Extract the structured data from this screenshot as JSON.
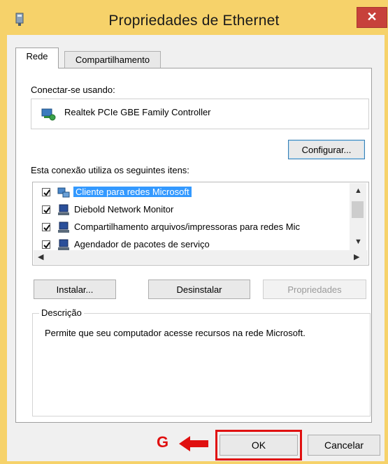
{
  "window": {
    "title": "Propriedades de Ethernet"
  },
  "tabs": [
    {
      "label": "Rede",
      "active": true
    },
    {
      "label": "Compartilhamento",
      "active": false
    }
  ],
  "connect_using": {
    "label": "Conectar-se usando:",
    "adapter": "Realtek PCIe GBE Family Controller",
    "configure_button": "Configurar..."
  },
  "items_section": {
    "label": "Esta conexão utiliza os seguintes itens:",
    "items": [
      {
        "checked": true,
        "text": "Cliente para redes Microsoft",
        "selected": true,
        "icon": "network-client-icon"
      },
      {
        "checked": true,
        "text": "Diebold Network Monitor",
        "selected": false,
        "icon": "network-service-icon"
      },
      {
        "checked": true,
        "text": "Compartilhamento arquivos/impressoras para redes Mic",
        "selected": false,
        "icon": "network-service-icon"
      },
      {
        "checked": true,
        "text": "Agendador de pacotes de serviço",
        "selected": false,
        "icon": "network-service-icon"
      }
    ]
  },
  "actions": {
    "install": "Instalar...",
    "uninstall": "Desinstalar",
    "properties": "Propriedades"
  },
  "description": {
    "title": "Descrição",
    "text": "Permite que seu computador acesse recursos na rede Microsoft."
  },
  "footer": {
    "ok": "OK",
    "cancel": "Cancelar"
  },
  "annotation": {
    "letter": "G",
    "color": "#e01010"
  },
  "colors": {
    "title_bar": "#f6d26a",
    "close_button": "#c7413b",
    "selection": "#3399ff"
  }
}
